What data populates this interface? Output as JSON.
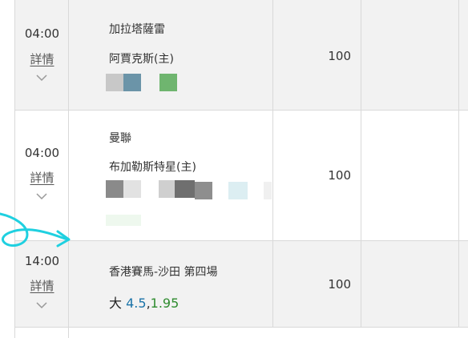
{
  "rows": [
    {
      "time": "04:00",
      "detail_label": "詳情",
      "team_away": "加拉塔薩雷",
      "team_home": "阿賈克斯(主)",
      "amount": "100"
    },
    {
      "time": "04:00",
      "detail_label": "詳情",
      "team_away": "曼聯",
      "team_home": "布加勒斯特星(主)",
      "amount": "100"
    },
    {
      "time": "14:00",
      "detail_label": "詳情",
      "race": "香港賽馬-沙田 第四場",
      "bet_type": "大",
      "line": "4.5",
      "comma": ",",
      "price": "1.95",
      "amount": "100"
    }
  ],
  "icons": {
    "expand": "chevron-down-icon"
  },
  "colors": {
    "line": "#1a73a8",
    "price": "#2e8b2e",
    "annotation": "#1fd0e0"
  }
}
